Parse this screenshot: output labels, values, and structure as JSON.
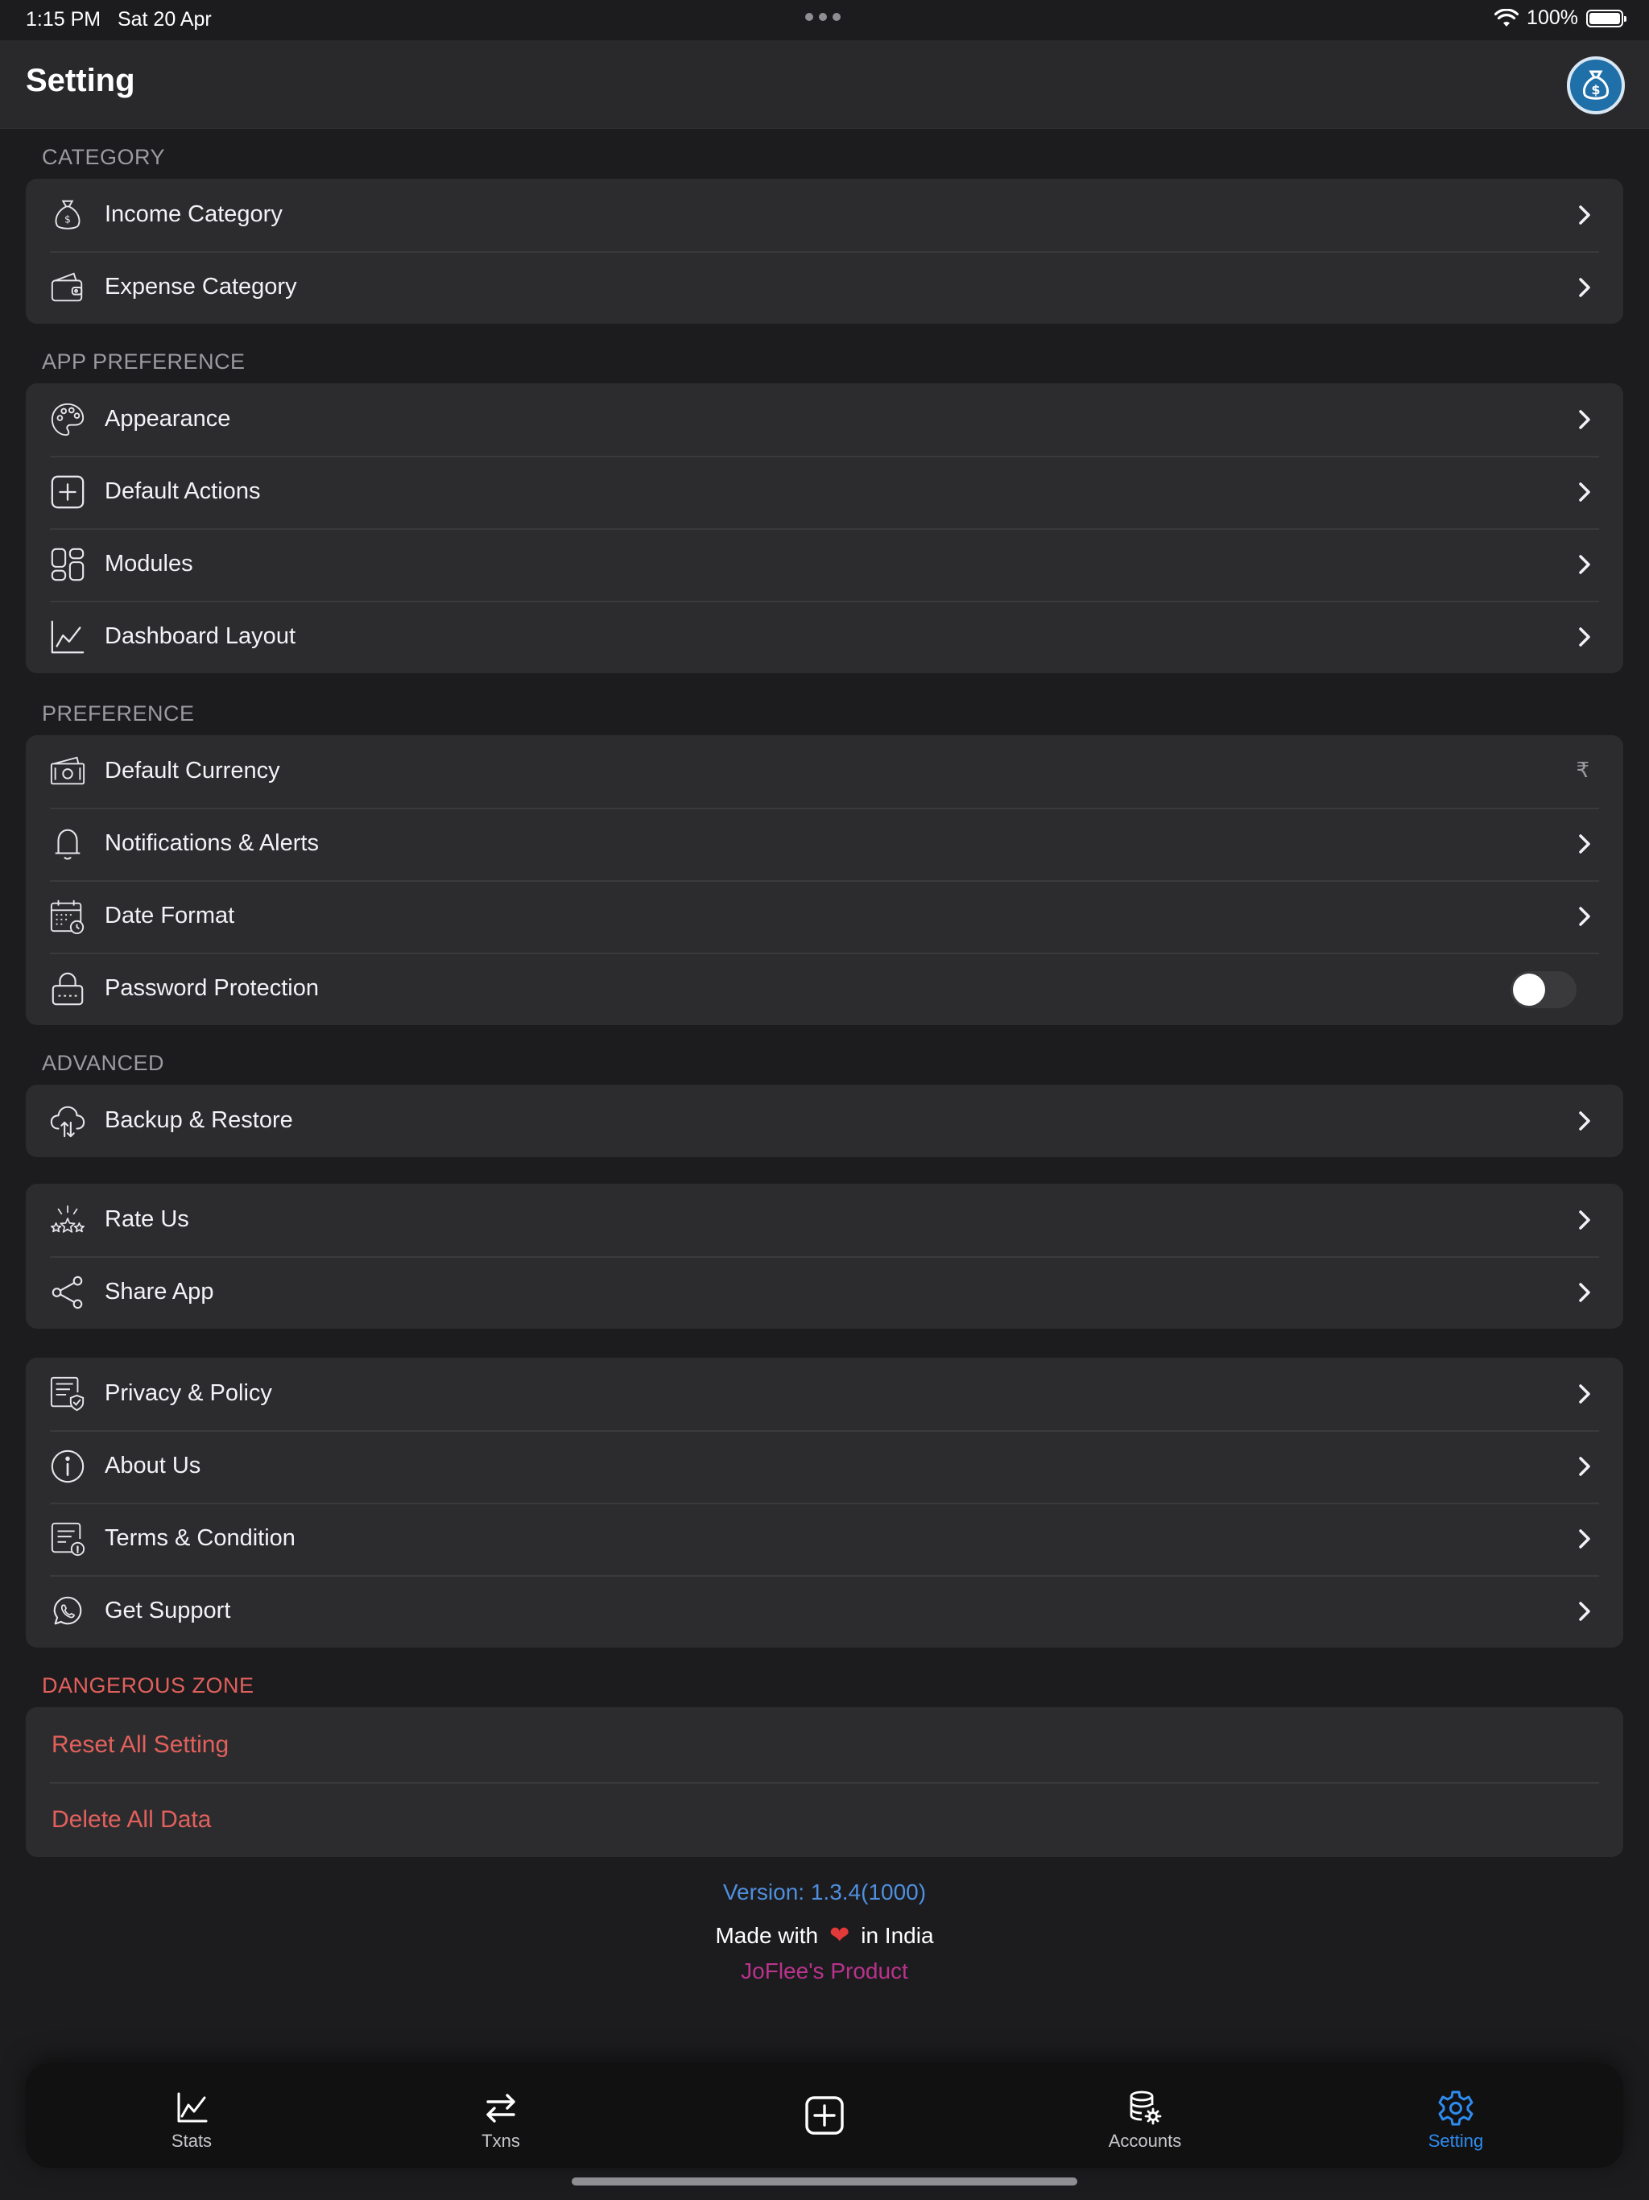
{
  "status_bar": {
    "time": "1:15 PM",
    "date": "Sat 20 Apr",
    "battery": "100%"
  },
  "header": {
    "title": "Setting"
  },
  "sections": {
    "category": {
      "title": "CATEGORY",
      "items": [
        {
          "label": "Income Category",
          "icon": "money-bag-icon"
        },
        {
          "label": "Expense Category",
          "icon": "wallet-icon"
        }
      ]
    },
    "app_preference": {
      "title": "APP PREFERENCE",
      "items": [
        {
          "label": "Appearance",
          "icon": "palette-icon"
        },
        {
          "label": "Default Actions",
          "icon": "plus-square-icon"
        },
        {
          "label": "Modules",
          "icon": "modules-icon"
        },
        {
          "label": "Dashboard Layout",
          "icon": "chart-line-icon"
        }
      ]
    },
    "preference": {
      "title": "PREFERENCE",
      "items": [
        {
          "label": "Default Currency",
          "icon": "cash-icon",
          "value": "₹"
        },
        {
          "label": "Notifications & Alerts",
          "icon": "bell-icon"
        },
        {
          "label": "Date Format",
          "icon": "calendar-clock-icon"
        },
        {
          "label": "Password Protection",
          "icon": "lock-icon",
          "toggle": false
        }
      ]
    },
    "advanced": {
      "title": "ADVANCED",
      "items": [
        {
          "label": "Backup & Restore",
          "icon": "cloud-sync-icon"
        }
      ]
    },
    "social": {
      "items": [
        {
          "label": "Rate Us",
          "icon": "stars-icon"
        },
        {
          "label": "Share App",
          "icon": "share-icon"
        }
      ]
    },
    "info": {
      "items": [
        {
          "label": "Privacy & Policy",
          "icon": "document-shield-icon"
        },
        {
          "label": "About Us",
          "icon": "info-circle-icon"
        },
        {
          "label": "Terms & Condition",
          "icon": "terms-document-icon"
        },
        {
          "label": "Get Support",
          "icon": "whatsapp-icon"
        }
      ]
    },
    "danger": {
      "title": "DANGEROUS ZONE",
      "items": [
        {
          "label": "Reset All Setting"
        },
        {
          "label": "Delete All Data"
        }
      ]
    }
  },
  "footer": {
    "version": "Version: 1.3.4(1000)",
    "made_prefix": "Made with",
    "made_suffix": "in India",
    "product": "JoFlee's Product"
  },
  "tab_bar": {
    "tabs": [
      {
        "label": "Stats",
        "icon": "stats-icon",
        "active": false
      },
      {
        "label": "Txns",
        "icon": "transfer-arrows-icon",
        "active": false
      },
      {
        "label": "",
        "icon": "add-square-icon",
        "active": false
      },
      {
        "label": "Accounts",
        "icon": "database-gear-icon",
        "active": false
      },
      {
        "label": "Setting",
        "icon": "gear-icon",
        "active": true
      }
    ]
  },
  "colors": {
    "background": "#1c1c1e",
    "card": "#2c2c2e",
    "accent_blue": "#2e8cf0",
    "danger": "#e2605c",
    "brand_pink": "#b8338c"
  }
}
